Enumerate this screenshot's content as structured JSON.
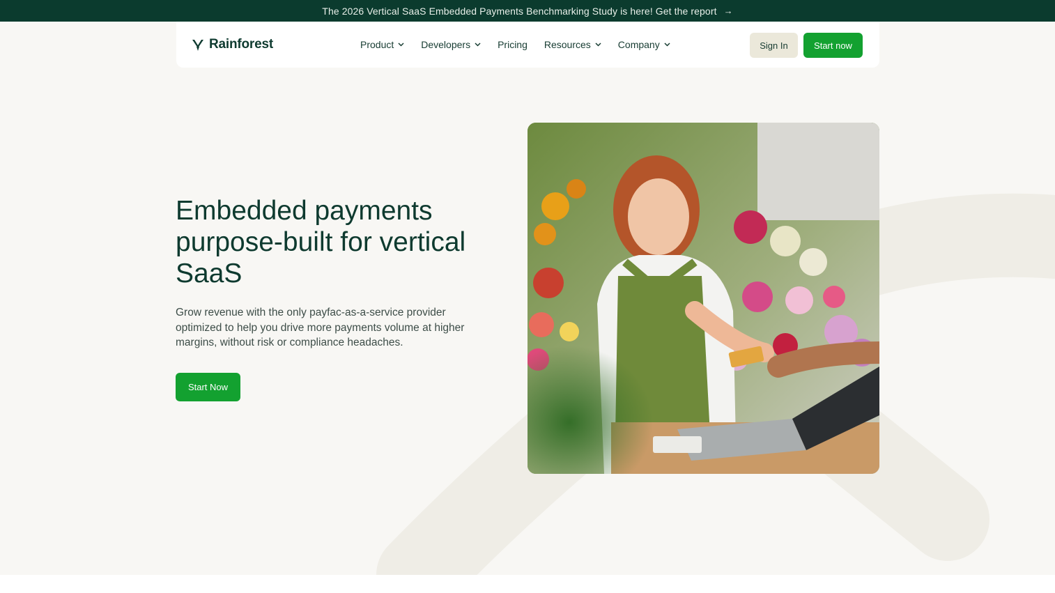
{
  "banner": {
    "text": "The 2026 Vertical SaaS Embedded Payments Benchmarking Study is here! Get the report",
    "arrow": "→"
  },
  "nav": {
    "brand": "Rainforest",
    "items": [
      {
        "label": "Product",
        "has_dropdown": true
      },
      {
        "label": "Developers",
        "has_dropdown": true
      },
      {
        "label": "Pricing",
        "has_dropdown": false
      },
      {
        "label": "Resources",
        "has_dropdown": true
      },
      {
        "label": "Company",
        "has_dropdown": true
      }
    ],
    "sign_in": "Sign In",
    "start": "Start now"
  },
  "hero": {
    "headline": "Embedded payments purpose-built for vertical SaaS",
    "subhead": "Grow revenue with the only payfac-as-a-service provider optimized to help you drive more payments volume at higher margins, without risk or compliance headaches.",
    "cta": "Start Now"
  },
  "colors": {
    "banner_bg": "#0b3b2e",
    "accent_green": "#13a130",
    "page_bg": "#f8f7f4",
    "text_dark": "#0f3b30"
  },
  "icons": {
    "logo": "leaf-logo-icon",
    "dropdown": "chevron-down-icon",
    "banner_arrow": "arrow-right-icon"
  }
}
